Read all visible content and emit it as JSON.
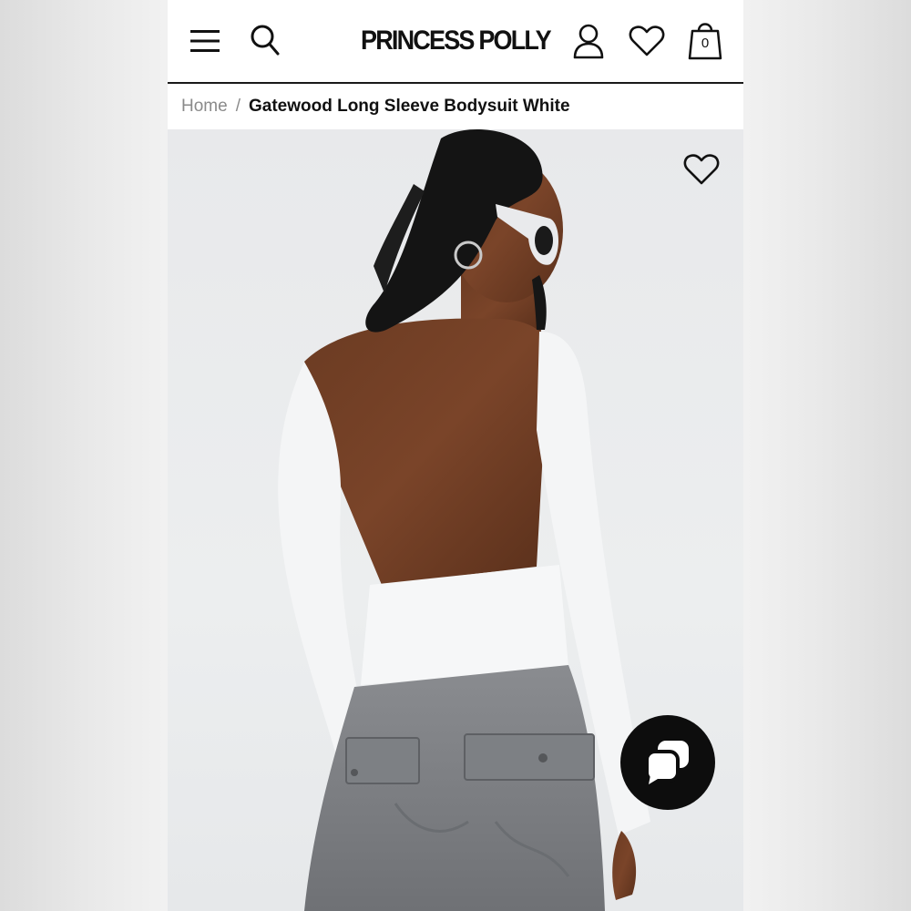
{
  "header": {
    "brand": "PRINCESS POLLY",
    "cart_count": "0",
    "icons": [
      "menu-icon",
      "search-icon",
      "account-icon",
      "heart-icon",
      "shopping-bag-icon"
    ]
  },
  "breadcrumb": {
    "home": "Home",
    "separator": "/",
    "current": "Gatewood Long Sleeve Bodysuit White"
  },
  "product_image": {
    "favorite_icon": "heart-icon",
    "chat_icon": "chat-bubbles-icon"
  },
  "colors": {
    "accent": "#111111",
    "muted_text": "#8a8a8a",
    "image_background": "#e8e9eb"
  }
}
